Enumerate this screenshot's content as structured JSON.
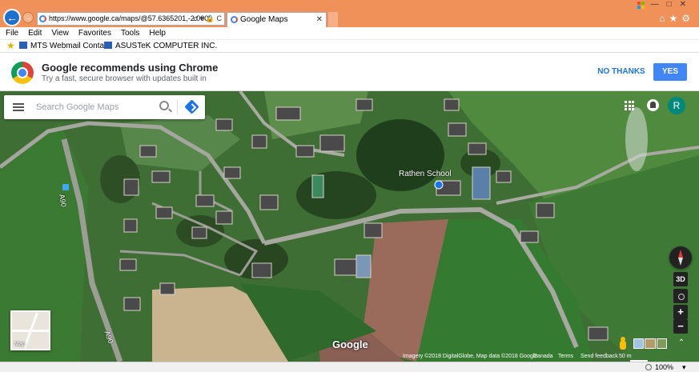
{
  "browser": {
    "url": "https://www.google.ca/maps/@57.6365201,-2.0000",
    "tab_title": "Google Maps",
    "menu": [
      "File",
      "Edit",
      "View",
      "Favorites",
      "Tools",
      "Help"
    ],
    "favorites": [
      "MTS Webmail Contact",
      "ASUSTeK COMPUTER INC."
    ],
    "zoom": "100%"
  },
  "promo": {
    "title": "Google recommends using Chrome",
    "subtitle": "Try a fast, secure browser with updates built in",
    "no_thanks": "NO THANKS",
    "yes": "YES"
  },
  "maps": {
    "search_placeholder": "Search Google Maps",
    "user_initial": "R",
    "place_label": "Rathen School",
    "road_label": "A90",
    "minimap_label": "Map",
    "view_3d": "3D",
    "zoom_in": "+",
    "zoom_out": "−",
    "logo": "Google",
    "attribution": "Imagery ©2018 DigitalGlobe, Map data ©2018 Google",
    "country": "Canada",
    "terms": "Terms",
    "feedback": "Send feedback",
    "scale": "50 m"
  },
  "icons": {
    "back": "back-arrow-icon",
    "forward": "forward-arrow-icon",
    "menu": "hamburger-menu-icon",
    "search": "search-icon",
    "directions": "directions-icon",
    "apps": "apps-grid-icon",
    "notifications": "notifications-icon",
    "compass": "compass-icon",
    "pegman": "pegman-icon"
  },
  "colors": {
    "titlebar": "#f0915a",
    "accent_blue": "#4285f4",
    "avatar": "#00897b"
  }
}
